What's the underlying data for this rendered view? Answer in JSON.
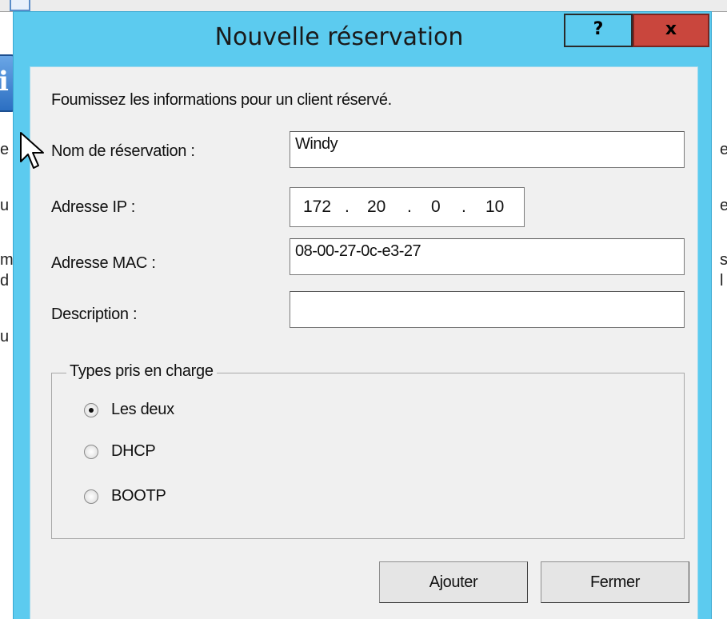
{
  "window": {
    "title": "Nouvelle réservation",
    "help_label": "?",
    "close_label": "x"
  },
  "form": {
    "intro": "Foumissez les informations pour un client réservé.",
    "fields": {
      "name_label": "Nom de réservation :",
      "name_value": "Windy",
      "ip_label": "Adresse IP :",
      "ip_octets": [
        "172",
        "20",
        "0",
        "10"
      ],
      "ip_dots": [
        ".",
        ".",
        "."
      ],
      "mac_label": "Adresse MAC :",
      "mac_value": "08-00-27-0c-e3-27",
      "description_label": "Description :",
      "description_value": ""
    },
    "types": {
      "group_label": "Types pris en charge",
      "options": [
        {
          "label": "Les deux",
          "checked": true
        },
        {
          "label": "DHCP",
          "checked": false
        },
        {
          "label": "BOOTP",
          "checked": false
        }
      ]
    },
    "buttons": {
      "add_label": "Ajouter",
      "close_label": "Fermer"
    }
  },
  "background": {
    "app_icon": "info-icon",
    "info_glyph": "i",
    "left_letters": [
      "e",
      "u",
      "m",
      "d",
      "u"
    ],
    "right_letters": [
      "e",
      "e",
      "s",
      "l"
    ]
  },
  "colors": {
    "titlebar": "#5ccbef",
    "close_button": "#c9463d",
    "client_area": "#f0f0f0"
  }
}
